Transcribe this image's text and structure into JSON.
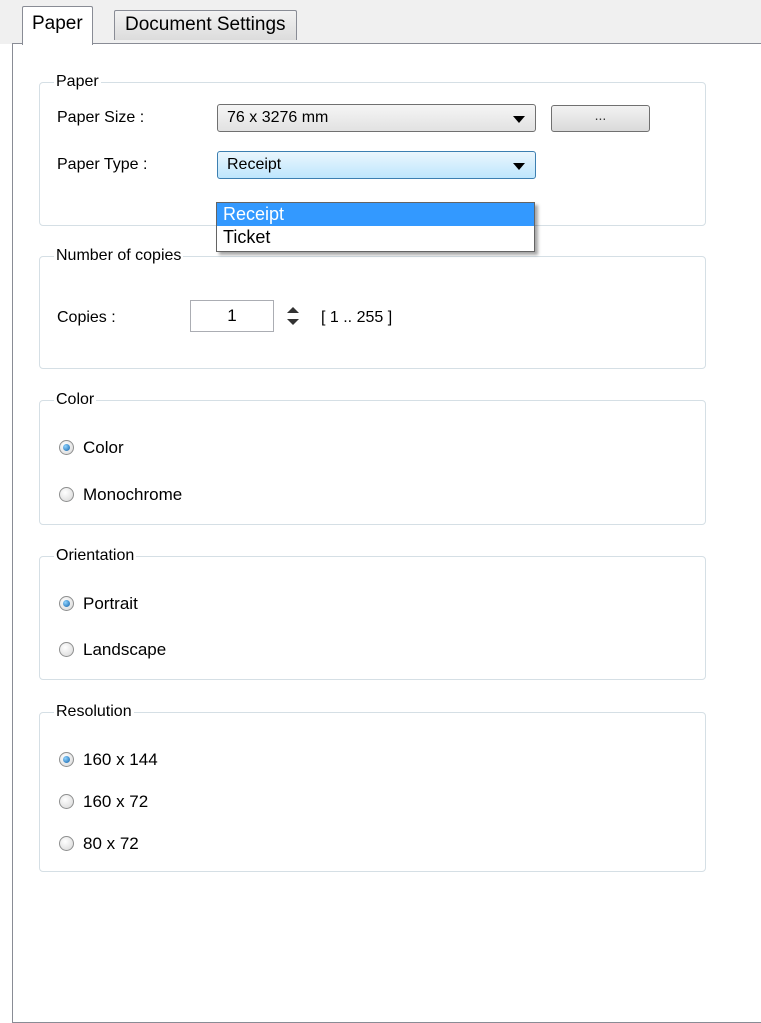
{
  "tabs": [
    {
      "label": "Paper",
      "active": true
    },
    {
      "label": "Document Settings",
      "active": false
    }
  ],
  "paper_group": {
    "title": "Paper",
    "paper_size_label": "Paper Size :",
    "paper_size_value": "76 x 3276 mm",
    "browse_button_label": "...",
    "paper_type_label": "Paper Type :",
    "paper_type_value": "Receipt",
    "paper_type_options": [
      "Receipt",
      "Ticket"
    ],
    "paper_type_selected": "Receipt"
  },
  "copies_group": {
    "title": "Number of copies",
    "copies_label": "Copies :",
    "copies_value": "1",
    "range_text": "[ 1 .. 255 ]"
  },
  "color_group": {
    "title": "Color",
    "options": [
      {
        "label": "Color",
        "checked": true
      },
      {
        "label": "Monochrome",
        "checked": false
      }
    ]
  },
  "orientation_group": {
    "title": "Orientation",
    "options": [
      {
        "label": "Portrait",
        "checked": true
      },
      {
        "label": "Landscape",
        "checked": false
      }
    ]
  },
  "resolution_group": {
    "title": "Resolution",
    "options": [
      {
        "label": "160 x 144",
        "checked": true
      },
      {
        "label": "160 x 72",
        "checked": false
      },
      {
        "label": "80 x 72",
        "checked": false
      }
    ]
  },
  "colors": {
    "selection": "#3399ff",
    "group_border": "#d5dfe5",
    "focus_border": "#3c7fb1"
  }
}
